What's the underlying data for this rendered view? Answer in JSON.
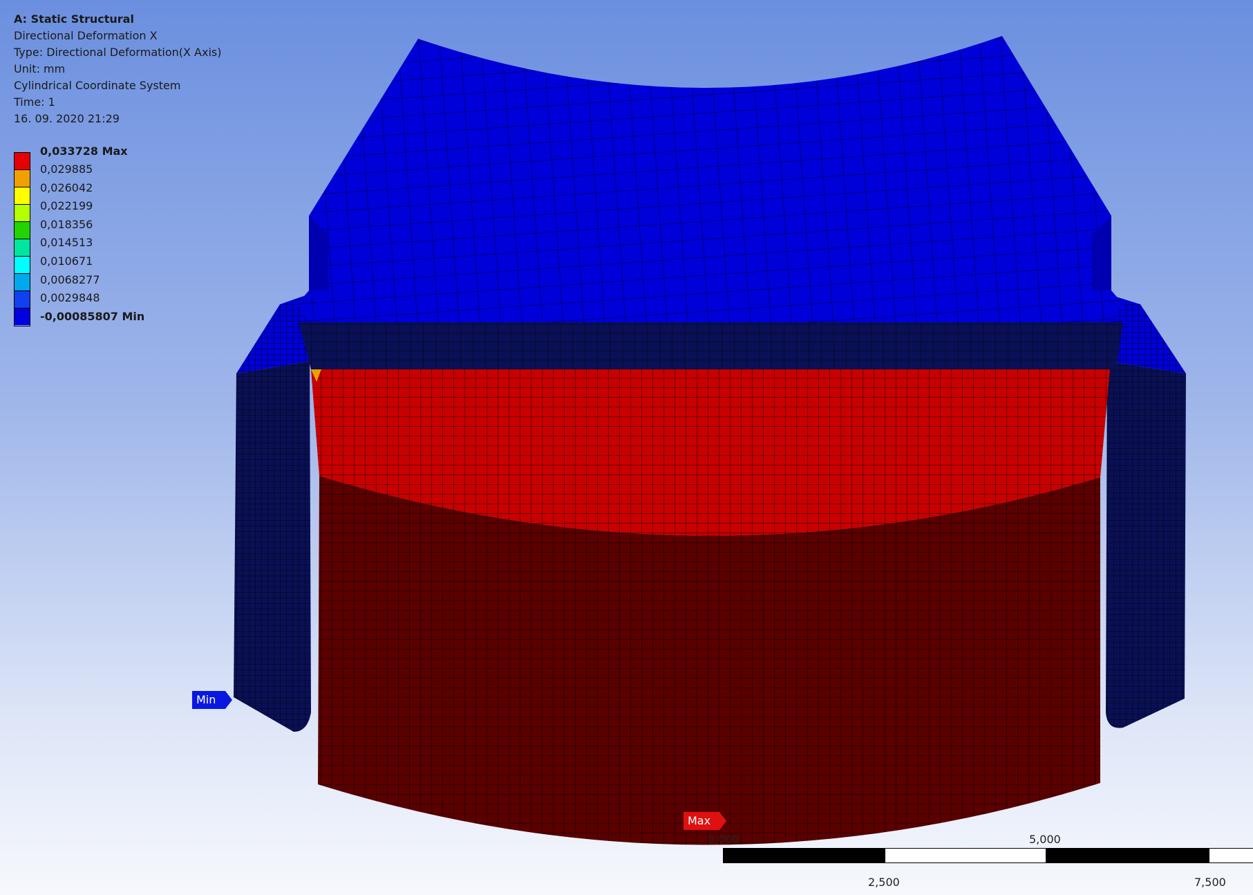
{
  "info": {
    "analysis": "A: Static Structural",
    "result": "Directional Deformation X",
    "type": "Type: Directional Deformation(X Axis)",
    "unit": "Unit: mm",
    "coordinate_system": "Cylindrical Coordinate System",
    "time": "Time: 1",
    "date": "16. 09. 2020 21:29"
  },
  "legend": {
    "levels": [
      {
        "label": "0,033728 Max",
        "color": "#e60000",
        "bold": true
      },
      {
        "label": "0,029885",
        "color": "#f0a000",
        "bold": false
      },
      {
        "label": "0,026042",
        "color": "#ffff00",
        "bold": false
      },
      {
        "label": "0,022199",
        "color": "#b4ff00",
        "bold": false
      },
      {
        "label": "0,018356",
        "color": "#22d400",
        "bold": false
      },
      {
        "label": "0,014513",
        "color": "#00e6a0",
        "bold": false
      },
      {
        "label": "0,010671",
        "color": "#00ffff",
        "bold": false
      },
      {
        "label": "0,0068277",
        "color": "#00a8ec",
        "bold": false
      },
      {
        "label": "0,0029848",
        "color": "#1040f0",
        "bold": false
      },
      {
        "label": "-0,00085807 Min",
        "color": null,
        "bold": true
      }
    ],
    "bottom_color": "#0000e0"
  },
  "probes": {
    "min": "Min",
    "max": "Max"
  },
  "scale_bar": {
    "ticks_top": [
      "0,000",
      "5,000"
    ],
    "ticks_bottom": [
      "2,500",
      "7,500"
    ]
  },
  "colors": {
    "blue": "#0000d8",
    "red": "#c80000",
    "dark_red": "#5a0000",
    "dark_blue": "#0a1055",
    "mesh_line": "#000000"
  }
}
